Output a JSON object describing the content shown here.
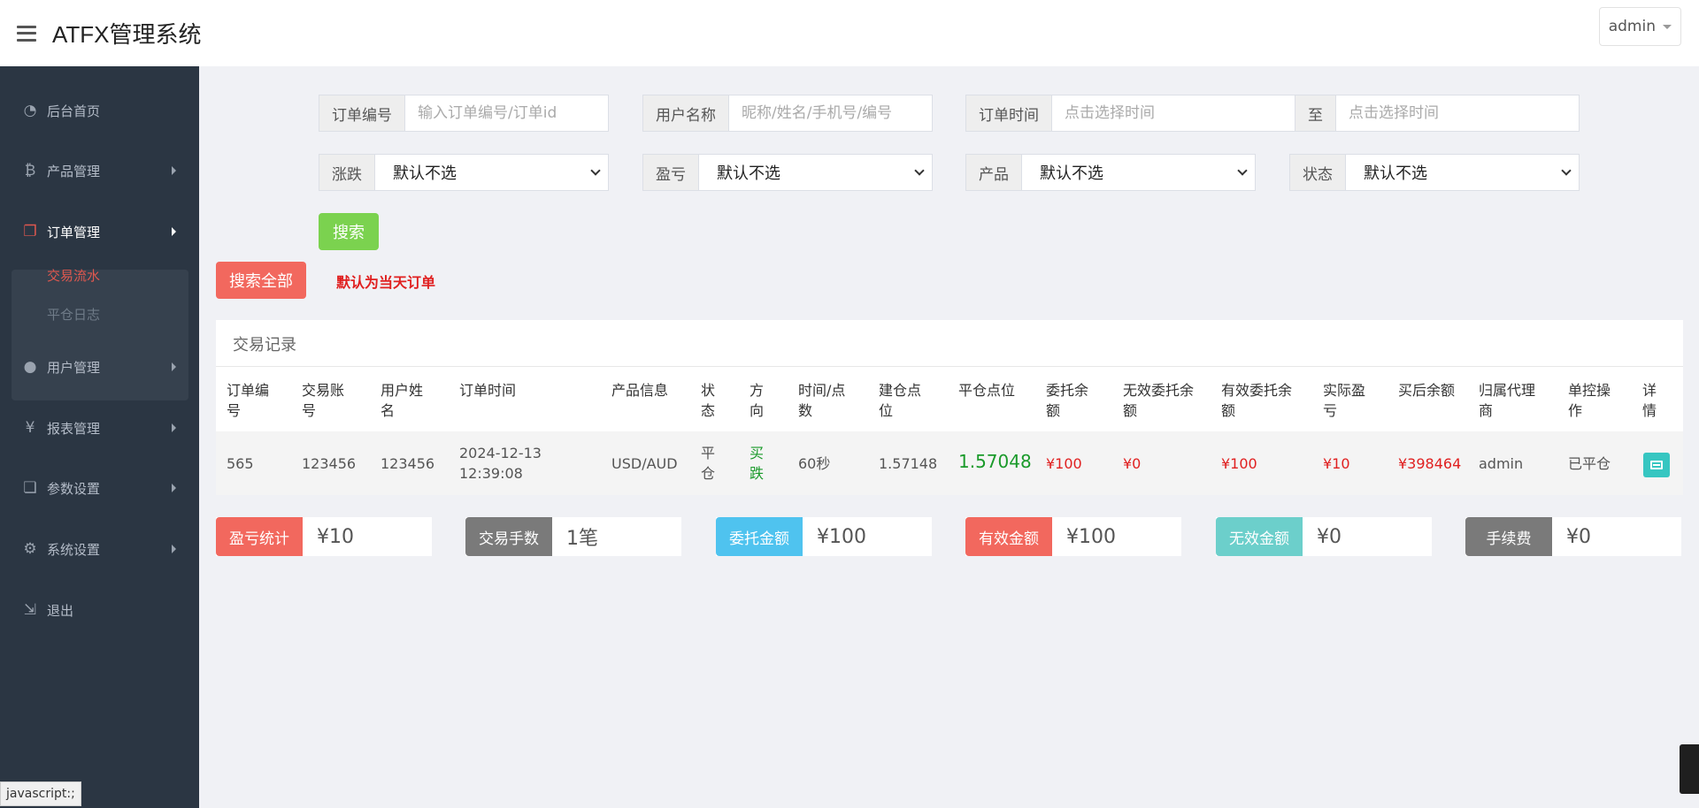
{
  "header": {
    "title": "ATFX管理系统",
    "user": "admin"
  },
  "sidebar": {
    "items": [
      {
        "label": "后台首页",
        "icon": "dashboard-icon"
      },
      {
        "label": "产品管理",
        "icon": "bitcoin-icon"
      },
      {
        "label": "订单管理",
        "icon": "copy-icon"
      },
      {
        "label": "用户管理",
        "icon": "user-icon"
      },
      {
        "label": "报表管理",
        "icon": "yen-icon"
      },
      {
        "label": "参数设置",
        "icon": "files-icon"
      },
      {
        "label": "系统设置",
        "icon": "gears-icon"
      },
      {
        "label": "退出",
        "icon": "sign-out-icon"
      }
    ],
    "subitems": [
      {
        "label": "交易流水"
      },
      {
        "label": "平仓日志"
      }
    ]
  },
  "filters": {
    "order_no_label": "订单编号",
    "order_no_placeholder": "输入订单编号/订单id",
    "user_label": "用户名称",
    "user_placeholder": "昵称/姓名/手机号/编号",
    "time_label": "订单时间",
    "time_start_placeholder": "点击选择时间",
    "to_label": "至",
    "time_end_placeholder": "点击选择时间",
    "updown_label": "涨跌",
    "updown_value": "默认不选",
    "pnl_label": "盈亏",
    "pnl_value": "默认不选",
    "product_label": "产品",
    "product_value": "默认不选",
    "status_label": "状态",
    "status_value": "默认不选"
  },
  "actions": {
    "search": "搜索",
    "search_all": "搜索全部",
    "note": "默认为当天订单"
  },
  "table": {
    "title": "交易记录",
    "headers": [
      [
        "订单编",
        "号"
      ],
      [
        "交易账",
        "号"
      ],
      [
        "用户姓",
        "名"
      ],
      [
        "",
        "订单时间"
      ],
      [
        "",
        "产品信息"
      ],
      [
        "状",
        "态"
      ],
      [
        "方",
        "向"
      ],
      [
        "时间/点",
        "数"
      ],
      [
        "建仓点",
        "位"
      ],
      [
        "",
        "平仓点位"
      ],
      [
        "委托余",
        "额"
      ],
      [
        "无效委托余",
        "额"
      ],
      [
        "有效委托余",
        "额"
      ],
      [
        "实际盈",
        "亏"
      ],
      [
        "",
        "买后余额"
      ],
      [
        "归属代理",
        "商"
      ],
      [
        "单控操",
        "作"
      ],
      [
        "详",
        "情"
      ]
    ],
    "row": {
      "order_no": "565",
      "account": "123456",
      "user_name": "123456",
      "time_date": "2024-12-13",
      "time_clock": "12:39:08",
      "product": "USD/AUD",
      "status_1": "平",
      "status_2": "仓",
      "direction_1": "买",
      "direction_2": "跌",
      "duration": "60秒",
      "open_price": "1.57148",
      "close_price": "1.57048",
      "entrust": "¥100",
      "invalid_entrust": "¥0",
      "valid_entrust": "¥100",
      "actual_pnl": "¥10",
      "balance_after": "¥398464",
      "agent": "admin",
      "control": "已平仓"
    }
  },
  "stats": [
    {
      "label": "盈亏统计",
      "value": "¥10",
      "color": "#f2685e"
    },
    {
      "label": "交易手数",
      "value": "1笔",
      "color": "#7a7a7a"
    },
    {
      "label": "委托金额",
      "value": "¥100",
      "color": "#4fc3ef"
    },
    {
      "label": "有效金额",
      "value": "¥100",
      "color": "#f2685e"
    },
    {
      "label": "无效金额",
      "value": "¥0",
      "color": "#6ccfcb"
    },
    {
      "label": "手续费",
      "value": "¥0",
      "color": "#7a7a7a"
    }
  ],
  "status_bar": "javascript:;"
}
